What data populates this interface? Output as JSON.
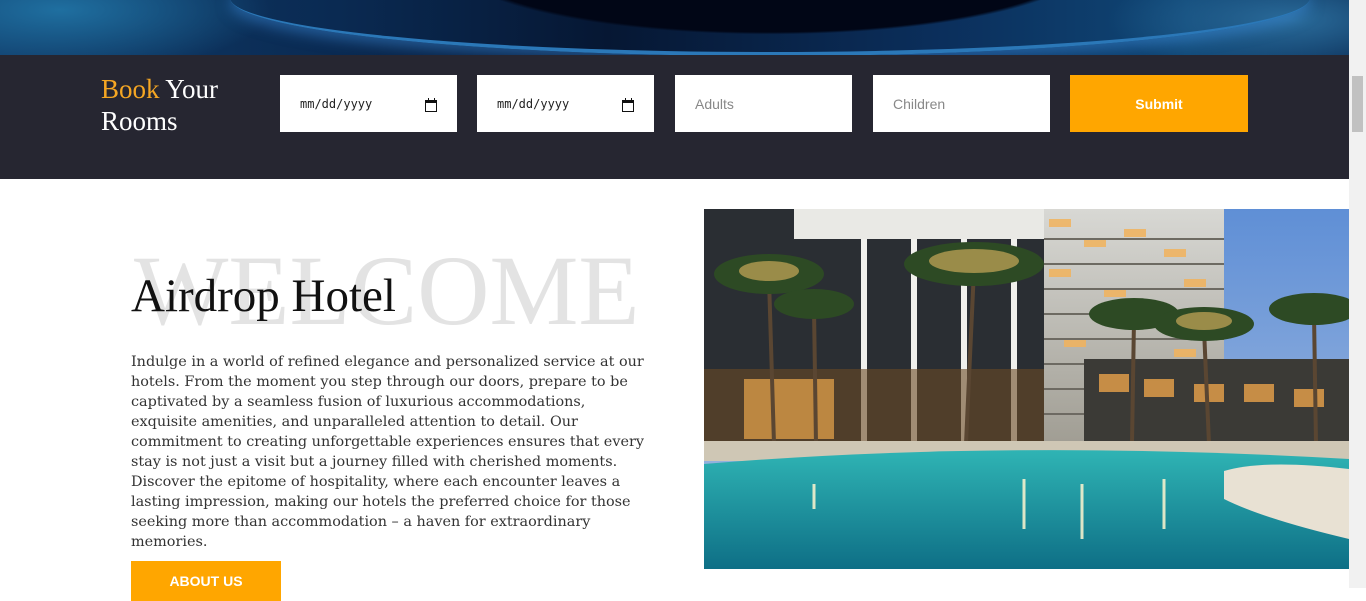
{
  "booking": {
    "title_accent": "Book",
    "title_rest": " Your Rooms",
    "checkin_placeholder": "mm/dd/yyyy",
    "checkout_placeholder": "mm/dd/yyyy",
    "adults_placeholder": "Adults",
    "children_placeholder": "Children",
    "submit_label": "Submit"
  },
  "welcome": {
    "watermark": "WELCOME",
    "title": "Airdrop Hotel",
    "description": "Indulge in a world of refined elegance and personalized service at our hotels. From the moment you step through our doors, prepare to be captivated by a seamless fusion of luxurious accommodations, exquisite amenities, and unparalleled attention to detail. Our commitment to creating unforgettable experiences ensures that every stay is not just a visit but a journey filled with cherished moments. Discover the epitome of hospitality, where each encounter leaves a lasting impression, making our hotels the preferred choice for those seeking more than accommodation – a haven for extraordinary memories.",
    "about_label": "ABOUT US"
  },
  "colors": {
    "accent": "#ffa600",
    "booking_bg": "#262631"
  },
  "icons": {
    "date": "calendar-icon"
  }
}
